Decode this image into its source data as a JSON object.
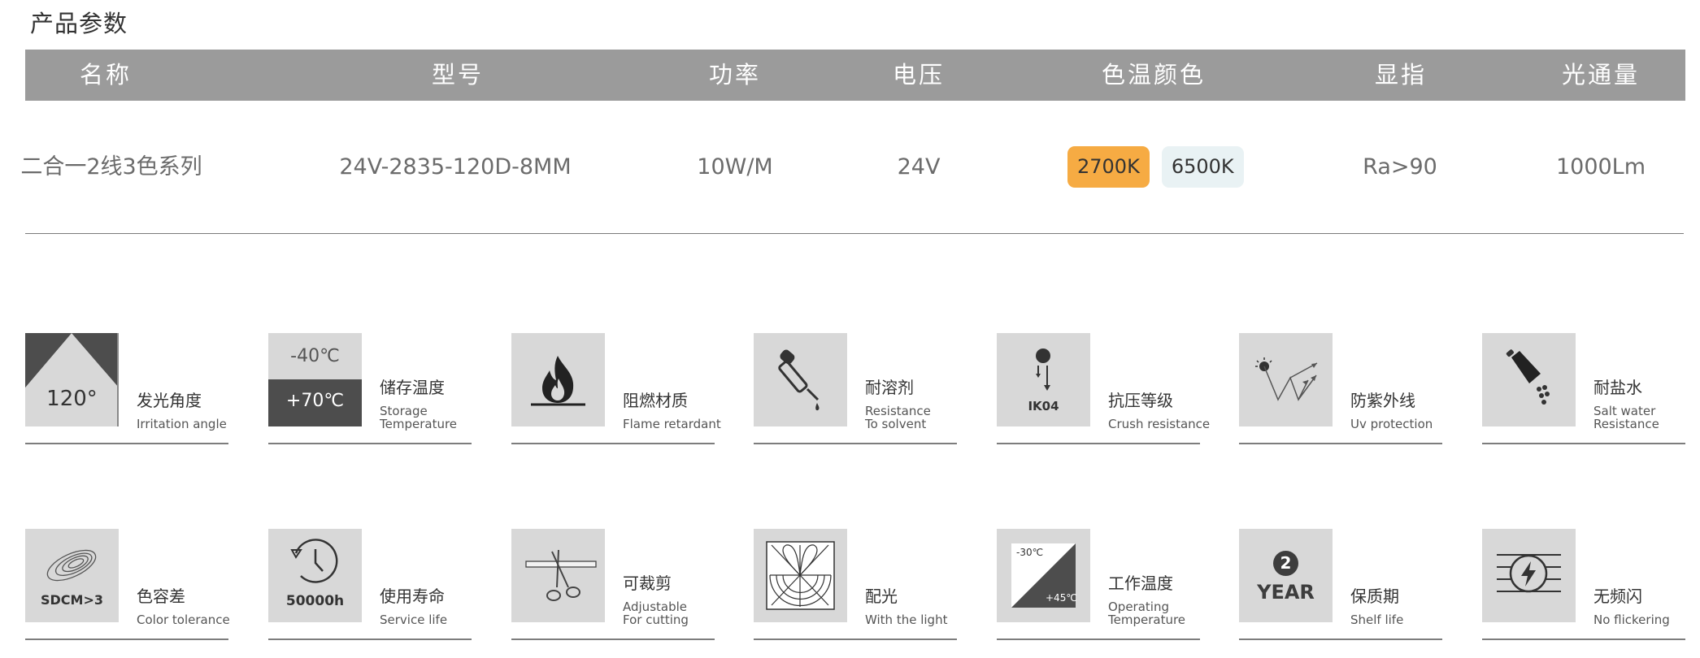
{
  "section_title": "产品参数",
  "table": {
    "headers": [
      "名称",
      "型号",
      "功率",
      "电压",
      "色温颜色",
      "显指",
      "光通量"
    ],
    "row": {
      "name": "二合一2线3色系列",
      "model": "24V-2835-120D-8MM",
      "power": "10W/M",
      "voltage": "24V",
      "cct": [
        "2700K",
        "6500K"
      ],
      "cri": "Ra>90",
      "flux": "1000Lm"
    }
  },
  "colors": {
    "header_bg": "#9b9b9b",
    "warm_badge": "#f6ab43",
    "cool_badge": "#e9f2f4",
    "icon_bg": "#d8d8d8",
    "icon_dark": "#4d4d4d"
  },
  "features": [
    {
      "icon": "beam-angle-icon",
      "icon_text": "120°",
      "cn": "发光角度",
      "en1": "Irritation angle",
      "en2": ""
    },
    {
      "icon": "storage-temperature-icon",
      "icon_text": "-40℃",
      "icon_text2": "+70℃",
      "cn": "储存温度",
      "en1": "Storage",
      "en2": "Temperature"
    },
    {
      "icon": "flame-icon",
      "cn": "阻燃材质",
      "en1": "Flame retardant",
      "en2": ""
    },
    {
      "icon": "dropper-icon",
      "cn": "耐溶剂",
      "en1": "Resistance",
      "en2": "To solvent"
    },
    {
      "icon": "crush-resistance-icon",
      "icon_text": "IK04",
      "cn": "抗压等级",
      "en1": "Crush resistance",
      "en2": ""
    },
    {
      "icon": "uv-protection-icon",
      "cn": "防紫外线",
      "en1": "Uv protection",
      "en2": ""
    },
    {
      "icon": "salt-water-icon",
      "cn": "耐盐水",
      "en1": "Salt water",
      "en2": "Resistance"
    },
    {
      "icon": "color-tolerance-icon",
      "icon_text": "SDCM>3",
      "cn": "色容差",
      "en1": "Color tolerance",
      "en2": ""
    },
    {
      "icon": "clock-icon",
      "icon_text": "50000h",
      "cn": "使用寿命",
      "en1": "Service life",
      "en2": ""
    },
    {
      "icon": "scissors-icon",
      "cn": "可裁剪",
      "en1": "Adjustable",
      "en2": "For cutting"
    },
    {
      "icon": "light-distribution-icon",
      "cn": "配光",
      "en1": "With the light",
      "en2": ""
    },
    {
      "icon": "operating-temperature-icon",
      "icon_text": "-30℃",
      "icon_text2": "+45℃",
      "cn": "工作温度",
      "en1": "Operating",
      "en2": "Temperature"
    },
    {
      "icon": "warranty-icon",
      "icon_text": "2",
      "icon_text2": "YEAR",
      "cn": "保质期",
      "en1": "Shelf life",
      "en2": ""
    },
    {
      "icon": "no-flicker-icon",
      "cn": "无频闪",
      "en1": "No flickering",
      "en2": ""
    }
  ]
}
